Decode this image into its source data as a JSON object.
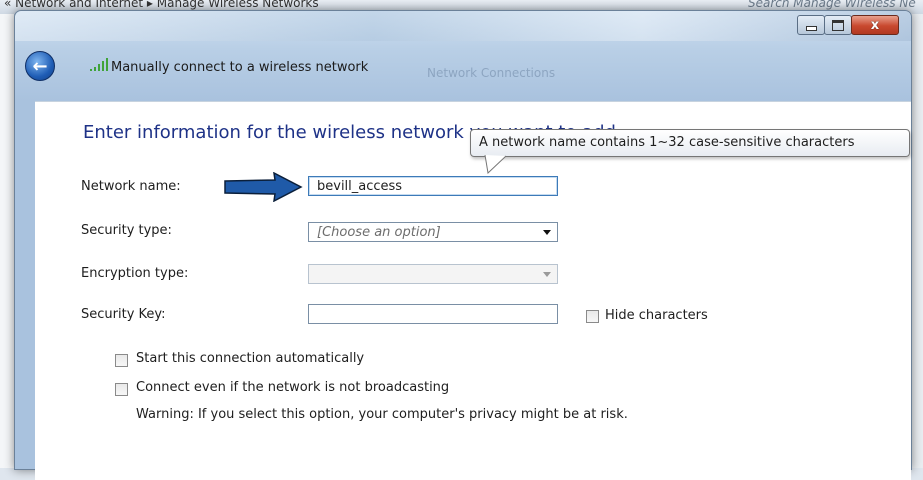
{
  "background_window": {
    "breadcrumb": "« Network and Internet ▸ Manage Wireless Networks",
    "search_placeholder": "Search Manage Wireless Ne"
  },
  "window": {
    "title": "Manually connect to a wireless network",
    "ghost_text": "Network Connections",
    "min_label": "",
    "max_label": "",
    "close_label": "x"
  },
  "form": {
    "heading": "Enter information for the wireless network you want to add",
    "network_name_label": "Network name:",
    "network_name_value": "bevill_access",
    "security_type_label": "Security type:",
    "security_type_value": "[Choose an option]",
    "encryption_type_label": "Encryption type:",
    "encryption_type_value": "",
    "security_key_label": "Security Key:",
    "security_key_value": "",
    "hide_characters_label": "Hide characters",
    "start_auto_label": "Start this connection automatically",
    "connect_even_label": "Connect even if the network is not broadcasting",
    "warning_text": "Warning: If you select this option, your computer's privacy might be at risk."
  },
  "tooltip": {
    "text": "A network name contains 1~32 case-sensitive characters"
  },
  "colors": {
    "heading": "#1e3287",
    "arrow_fill": "#1f5aa8",
    "close_button": "#c8492f"
  }
}
